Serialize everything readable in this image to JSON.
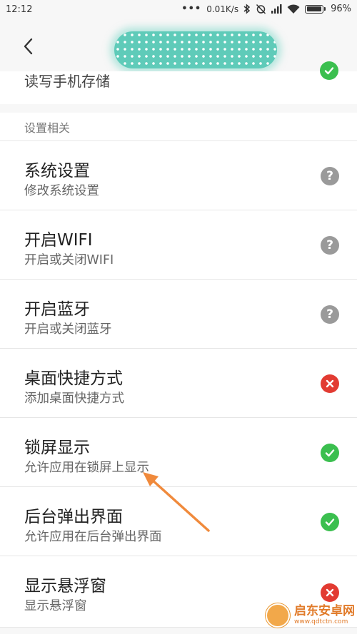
{
  "status_bar": {
    "time": "12:12",
    "dots": "•••",
    "speed": "0.01K/s",
    "battery_text": "96%",
    "battery_level": 0.96,
    "icons": [
      "bluetooth-icon",
      "alarm-off-icon",
      "signal-icon",
      "wifi-icon",
      "battery-icon"
    ]
  },
  "header": {
    "back_icon": "chevron-left-icon",
    "title_mask": "redacted-title"
  },
  "partial_item": {
    "description": "读写手机存储",
    "status": "allowed"
  },
  "section": {
    "title": "设置相关"
  },
  "items": [
    {
      "title": "系统设置",
      "description": "修改系统设置",
      "status": "ask"
    },
    {
      "title": "开启WIFI",
      "description": "开启或关闭WIFI",
      "status": "ask"
    },
    {
      "title": "开启蓝牙",
      "description": "开启或关闭蓝牙",
      "status": "ask"
    },
    {
      "title": "桌面快捷方式",
      "description": "添加桌面快捷方式",
      "status": "denied"
    },
    {
      "title": "锁屏显示",
      "description": "允许应用在锁屏上显示",
      "status": "allowed"
    },
    {
      "title": "后台弹出界面",
      "description": "允许应用在后台弹出界面",
      "status": "allowed"
    },
    {
      "title": "显示悬浮窗",
      "description": "显示悬浮窗",
      "status": "denied"
    }
  ],
  "annotation": {
    "arrow_color": "#f08a3c"
  },
  "watermark": {
    "name": "启东安卓网",
    "url": "www.qdtctn.com"
  },
  "colors": {
    "allowed": "#3bbf4f",
    "denied": "#e23b32",
    "ask": "#9a9a9a",
    "background": "#f7f7f7"
  }
}
